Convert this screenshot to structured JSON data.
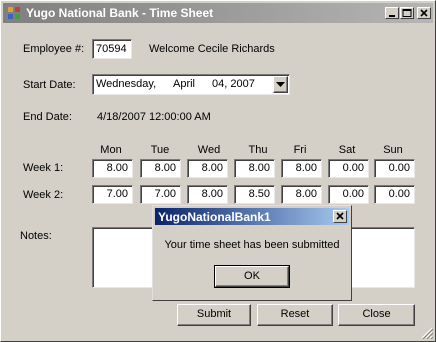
{
  "window": {
    "title": "Yugo National Bank - Time Sheet"
  },
  "employee": {
    "label": "Employee #:",
    "value": "70594",
    "welcome": "Welcome Cecile Richards"
  },
  "start": {
    "label": "Start Date:",
    "weekday": "Wednesday,",
    "month": "April",
    "day": "04, 2007"
  },
  "end": {
    "label": "End Date:",
    "value": "4/18/2007 12:00:00 AM"
  },
  "days": [
    "Mon",
    "Tue",
    "Wed",
    "Thu",
    "Fri",
    "Sat",
    "Sun"
  ],
  "weeks": [
    {
      "label": "Week 1:",
      "hours": [
        "8.00",
        "8.00",
        "8.00",
        "8.00",
        "8.00",
        "0.00",
        "0.00"
      ]
    },
    {
      "label": "Week 2:",
      "hours": [
        "7.00",
        "7.00",
        "8.00",
        "8.50",
        "8.00",
        "0.00",
        "0.00"
      ]
    }
  ],
  "notes": {
    "label": "Notes:",
    "value": ""
  },
  "buttons": {
    "submit": "Submit",
    "reset": "Reset",
    "close": "Close"
  },
  "dialog": {
    "title": "YugoNationalBank1",
    "message": "Your time sheet has been submitted",
    "ok": "OK"
  }
}
